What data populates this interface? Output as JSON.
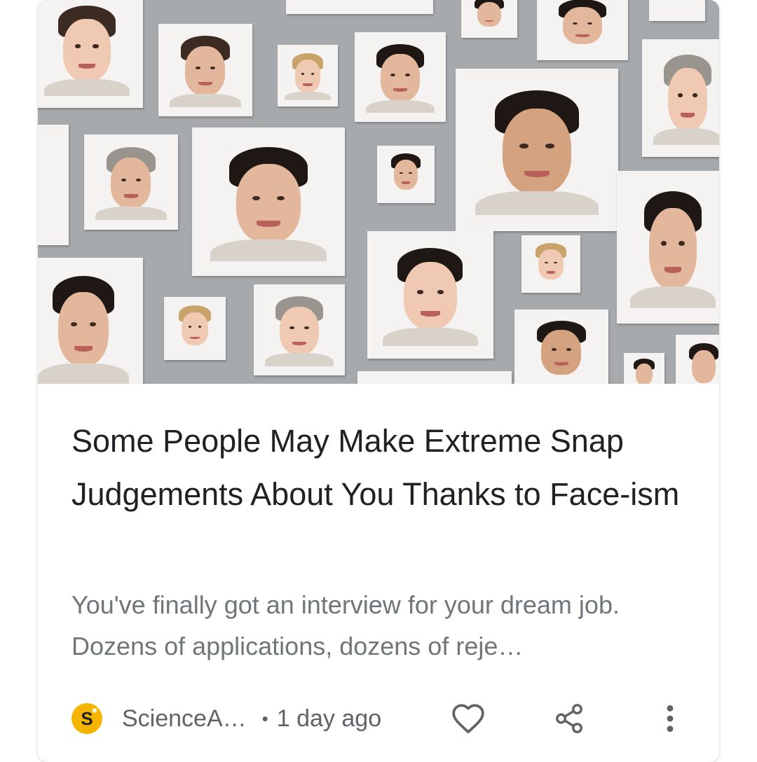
{
  "article": {
    "title": "Some People May Make Extreme Snap Judgements About You Thanks to Face-ism",
    "snippet": "You've finally got an interview for your dream job. Dozens of applications, dozens of reje…",
    "source": {
      "name": "ScienceA…",
      "logo_letter": "S",
      "logo_mark": "✱",
      "logo_color": "#f5b400"
    },
    "separator": "•",
    "time": "1 day ago",
    "image_description_icon": "portrait-collage-image"
  },
  "actions": {
    "like_icon": "heart-outline-icon",
    "share_icon": "share-icon",
    "more_icon": "more-vertical-icon"
  },
  "colors": {
    "title": "#202124",
    "snippet": "#70757a",
    "meta": "#5f6368",
    "hero_background": "#a7aaac"
  }
}
